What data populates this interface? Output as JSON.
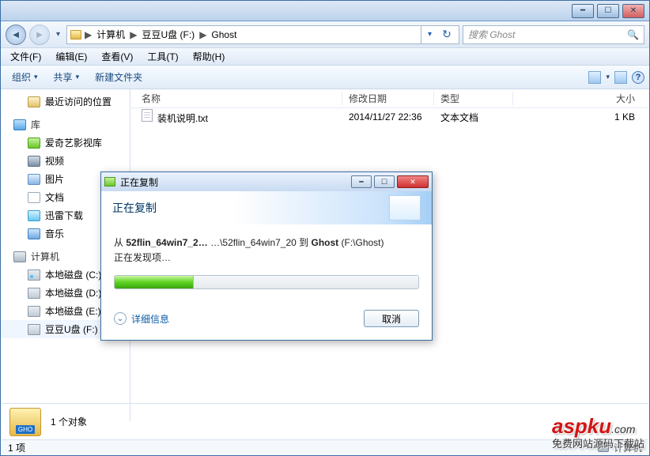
{
  "window": {
    "minimize": "━",
    "maximize": "☐",
    "close": "✕"
  },
  "nav": {
    "back": "◄",
    "forward": "►",
    "drop": "▾",
    "refresh": "↻"
  },
  "breadcrumb": {
    "root": "计算机",
    "drive": "豆豆U盘 (F:)",
    "folder": "Ghost",
    "sep": "▶"
  },
  "search": {
    "placeholder": "搜索 Ghost",
    "icon": "🔍"
  },
  "menu": {
    "file": "文件(F)",
    "edit": "编辑(E)",
    "view": "查看(V)",
    "tool": "工具(T)",
    "help": "帮助(H)"
  },
  "toolbar": {
    "org": "组织",
    "share": "共享",
    "newf": "新建文件夹",
    "drop": "▾",
    "views": "☰",
    "help": "?"
  },
  "sidebar": {
    "recent": "最近访问的位置",
    "libs": "库",
    "libs_items": [
      "爱奇艺影视库",
      "视频",
      "图片",
      "文档",
      "迅雷下载",
      "音乐"
    ],
    "computer": "计算机",
    "drives": [
      "本地磁盘 (C:)",
      "本地磁盘 (D:)",
      "本地磁盘 (E:)",
      "豆豆U盘 (F:)"
    ]
  },
  "columns": {
    "name": "名称",
    "date": "修改日期",
    "type": "类型",
    "size": "大小"
  },
  "file": {
    "name": "装机说明.txt",
    "date": "2014/11/27 22:36",
    "type": "文本文档",
    "size": "1 KB"
  },
  "status": {
    "gho": "GHO",
    "objects": "1 个对象",
    "items": "1 项",
    "pc": "计算机"
  },
  "dialog": {
    "title": "正在复制",
    "header": "正在复制",
    "from_label": "从 ",
    "src_bold": "52flin_64win7_2…",
    "src_rest": "   …\\52flin_64win7_20 到 ",
    "dst_bold": "Ghost",
    "dst_rest": " (F:\\Ghost)",
    "finding": "正在发现项…",
    "details": "详细信息",
    "cancel": "取消",
    "min": "━",
    "max": "☐",
    "close": "✕"
  },
  "watermark": {
    "brand": "aspku",
    "com": ".com",
    "tag": "免费网站源码下载站"
  }
}
